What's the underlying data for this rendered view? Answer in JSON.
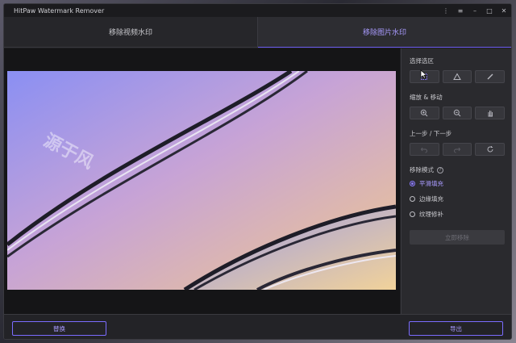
{
  "window": {
    "title": "HitPaw Watermark Remover",
    "controls": [
      "⋮",
      "≡",
      "–",
      "□",
      "✕"
    ]
  },
  "tabs": [
    {
      "label": "移除视频水印",
      "active": false
    },
    {
      "label": "移除图片水印",
      "active": true
    }
  ],
  "preview": {
    "watermark_text": "源于风"
  },
  "panel": {
    "select_label": "选择选区",
    "zoom_label": "缩放 & 移动",
    "undo_label": "上一步 / 下一步",
    "mode_label": "移除模式",
    "help_icon": "?",
    "modes": [
      {
        "label": "平滑填充",
        "selected": true
      },
      {
        "label": "边缘填充",
        "selected": false
      },
      {
        "label": "纹理修补",
        "selected": false
      }
    ],
    "remove_now": "立即移除"
  },
  "footer": {
    "replace": "替换",
    "export": "导出"
  },
  "colors": {
    "accent": "#8b7bff",
    "background": "#1f1f22",
    "panel": "#2a2a2e"
  }
}
